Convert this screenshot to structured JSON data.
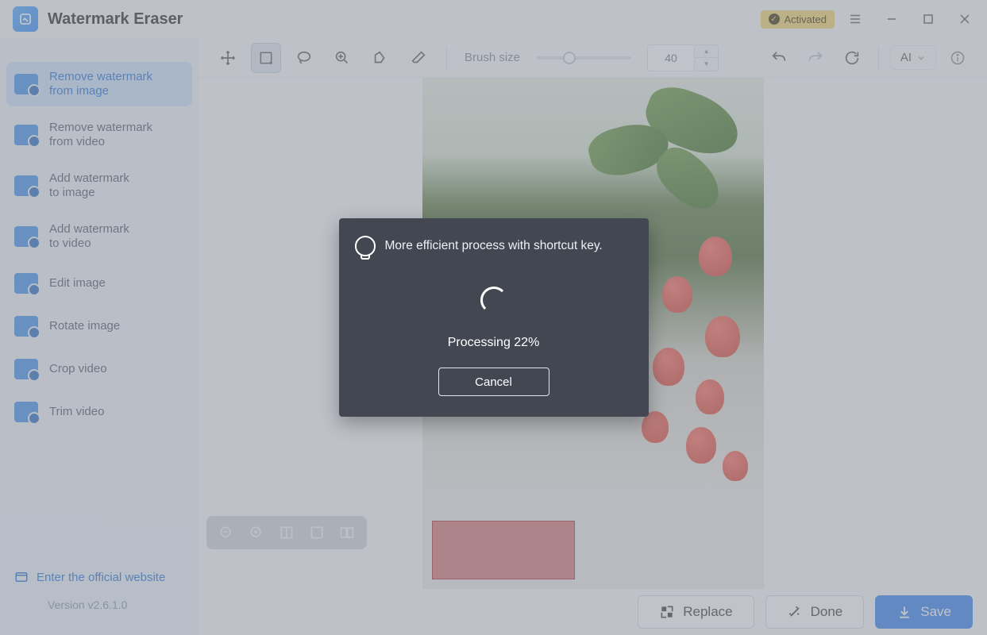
{
  "app": {
    "title": "Watermark Eraser"
  },
  "titlebar": {
    "activated_label": "Activated"
  },
  "sidebar": {
    "items": [
      {
        "label": "Remove watermark\nfrom image",
        "active": true
      },
      {
        "label": "Remove watermark\nfrom video"
      },
      {
        "label": "Add watermark\nto image"
      },
      {
        "label": "Add watermark\nto video"
      },
      {
        "label": "Edit image"
      },
      {
        "label": "Rotate image"
      },
      {
        "label": "Crop video"
      },
      {
        "label": "Trim video"
      }
    ],
    "official_link": "Enter the official website",
    "version": "Version v2.6.1.0"
  },
  "toolbar": {
    "brush_label": "Brush size",
    "brush_value": "40",
    "ai_label": "AI"
  },
  "footer": {
    "replace": "Replace",
    "done": "Done",
    "save": "Save"
  },
  "modal": {
    "tip": "More efficient process with shortcut key.",
    "processing_prefix": "Processing ",
    "processing_value": "22%",
    "cancel": "Cancel"
  }
}
